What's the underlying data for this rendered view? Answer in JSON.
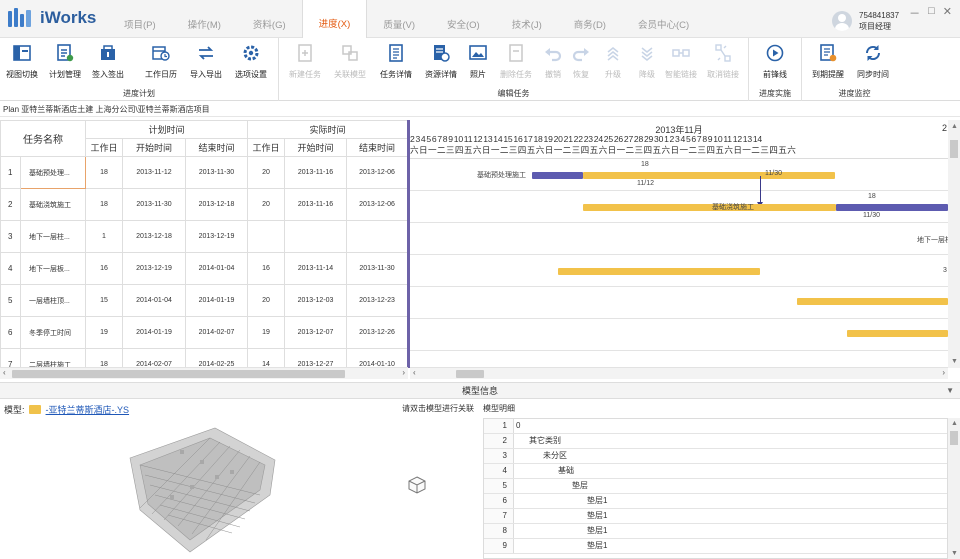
{
  "app": {
    "title": "iWorks"
  },
  "menu": [
    "项目(P)",
    "操作(M)",
    "资料(G)",
    "进度(X)",
    "质量(V)",
    "安全(O)",
    "技术(J)",
    "商务(D)",
    "会员中心(C)"
  ],
  "user": {
    "id": "754841837",
    "role": "项目经理"
  },
  "window_controls": [
    "－",
    "□",
    "✕"
  ],
  "ribbon": {
    "g1": {
      "label": "进度计划",
      "buttons": [
        "视图切换",
        "计划管理",
        "签入签出",
        "工作日历",
        "导入导出",
        "选项设置"
      ]
    },
    "g2": {
      "label": "编辑任务",
      "buttons": [
        "新建任务",
        "关联模型",
        "任务详情",
        "资源详情",
        "照片",
        "删除任务",
        "撤销",
        "恢复",
        "升级",
        "降级",
        "智能链接",
        "取消链接"
      ]
    },
    "g3": {
      "label": "进度实施",
      "buttons": [
        "前锋线"
      ]
    },
    "g4": {
      "label": "进度监控",
      "buttons": [
        "到期提醒",
        "同步时间"
      ]
    }
  },
  "breadcrumb": "Plan 亚特兰蒂斯酒店土建 上海分公司\\亚特兰蒂斯酒店项目",
  "table": {
    "col_name": "任务名称",
    "group_plan": "计划时间",
    "group_actual": "实际时间",
    "col_days": "工作日",
    "col_start": "开始时间",
    "col_end": "结束时间",
    "rows": [
      {
        "idx": "1",
        "name": "基础预处理...",
        "pd": "18",
        "ps": "2013-11-12",
        "pe": "2013-11-30",
        "ad": "20",
        "as": "2013-11-16",
        "ae": "2013-12-06"
      },
      {
        "idx": "2",
        "name": "基础浇筑施工",
        "pd": "18",
        "ps": "2013-11-30",
        "pe": "2013-12-18",
        "ad": "20",
        "as": "2013-11-16",
        "ae": "2013-12-06"
      },
      {
        "idx": "3",
        "name": "地下一层柱...",
        "pd": "1",
        "ps": "2013-12-18",
        "pe": "2013-12-19",
        "ad": "",
        "as": "",
        "ae": ""
      },
      {
        "idx": "4",
        "name": "地下一层板...",
        "pd": "16",
        "ps": "2013-12-19",
        "pe": "2014-01-04",
        "ad": "16",
        "as": "2013-11-14",
        "ae": "2013-11-30"
      },
      {
        "idx": "5",
        "name": "一层墙柱顶...",
        "pd": "15",
        "ps": "2014-01-04",
        "pe": "2014-01-19",
        "ad": "20",
        "as": "2013-12-03",
        "ae": "2013-12-23"
      },
      {
        "idx": "6",
        "name": "冬季停工时间",
        "pd": "19",
        "ps": "2014-01-19",
        "pe": "2014-02-07",
        "ad": "19",
        "as": "2013-12-07",
        "ae": "2013-12-26"
      },
      {
        "idx": "7",
        "name": "二层墙柱施工",
        "pd": "18",
        "ps": "2014-02-07",
        "pe": "2014-02-25",
        "ad": "14",
        "as": "2013-12-27",
        "ae": "2014-01-10"
      }
    ]
  },
  "gantt": {
    "month": "2013年11月",
    "month_next": "2",
    "day_numbers": "2 3 4 5 6 7 8 9 10 11 12 13 14 15 16 17 18 19 20 21 22 23 24 25 26 27 28 29 30 1 2 3 4 5 6 7 8 9 10 11 12 13 14",
    "weekdays": "六 日 一 二 三 四 五 六 日 一 二 三 四 五 六 日 一 二 三 四 五 六 日 一 二 三 四 五 六 日 一 二 三 四 五 六 日 一 二 三 四 五 六",
    "labels": {
      "r1_num": "18",
      "r1_name": "基础预处理施工",
      "r1_start": "11/12",
      "r1_end": "11/30",
      "r2_num": "18",
      "r2_name": "基础浇筑施工",
      "r2_end": "11/30",
      "r3_name": "地下一层柱",
      "r4_edge": "3"
    },
    "colors": {
      "plan": "#f2c24a",
      "actual": "#5d5bb0",
      "divider": "#6d62a8"
    }
  },
  "info": {
    "header": "模型信息",
    "model_label": "模型:",
    "model_name": "-亚特兰蒂斯酒店-.YS",
    "hint": "请双击模型进行关联",
    "tab": "模型明细"
  },
  "tree": [
    {
      "n": "1",
      "t": "0",
      "lvl": 0
    },
    {
      "n": "2",
      "t": "其它类别",
      "lvl": 1
    },
    {
      "n": "3",
      "t": "未分区",
      "lvl": 2
    },
    {
      "n": "4",
      "t": "基础",
      "lvl": 3
    },
    {
      "n": "5",
      "t": "垫层",
      "lvl": 4
    },
    {
      "n": "6",
      "t": "垫层1",
      "lvl": 5
    },
    {
      "n": "7",
      "t": "垫层1",
      "lvl": 5
    },
    {
      "n": "8",
      "t": "垫层1",
      "lvl": 5
    },
    {
      "n": "9",
      "t": "垫层1",
      "lvl": 5
    }
  ]
}
